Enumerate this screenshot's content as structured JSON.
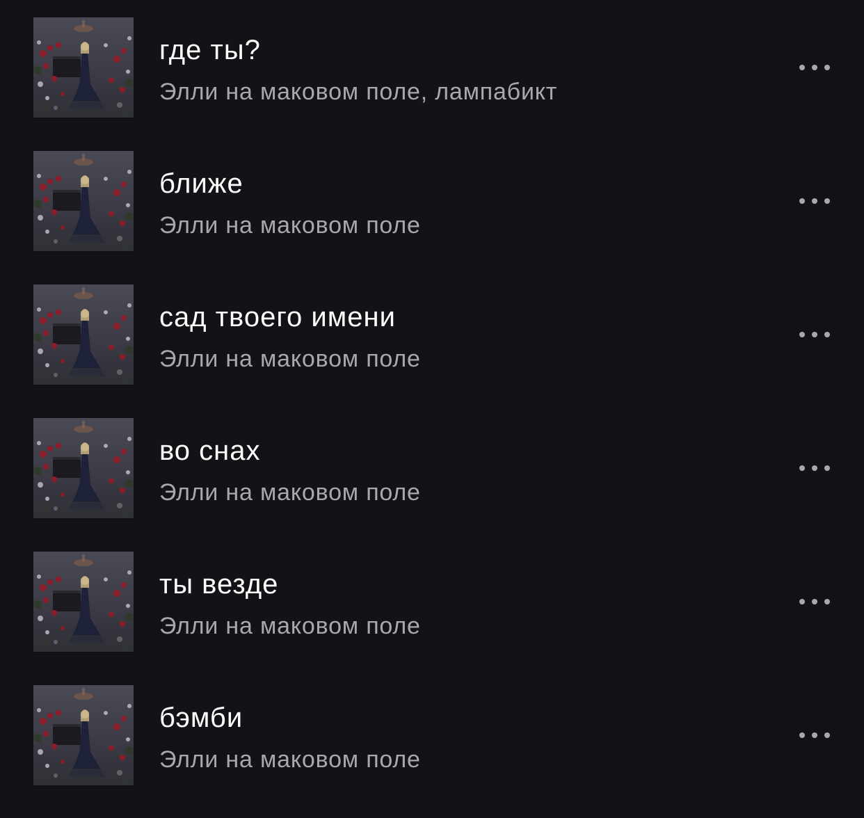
{
  "tracks": [
    {
      "title": "где ты?",
      "artist": "Элли на маковом поле, лампабикт"
    },
    {
      "title": "ближе",
      "artist": "Элли на маковом поле"
    },
    {
      "title": "сад твоего имени",
      "artist": "Элли на маковом поле"
    },
    {
      "title": "во снах",
      "artist": "Элли на маковом поле"
    },
    {
      "title": "ты везде",
      "artist": "Элли на маковом поле"
    },
    {
      "title": "бэмби",
      "artist": "Элли на маковом поле"
    }
  ],
  "icons": {
    "more": "more-horizontal-icon",
    "cover": "album-cover-image"
  },
  "colors": {
    "background": "#141216",
    "title": "#ffffff",
    "subtitle": "#a9a8ad"
  }
}
